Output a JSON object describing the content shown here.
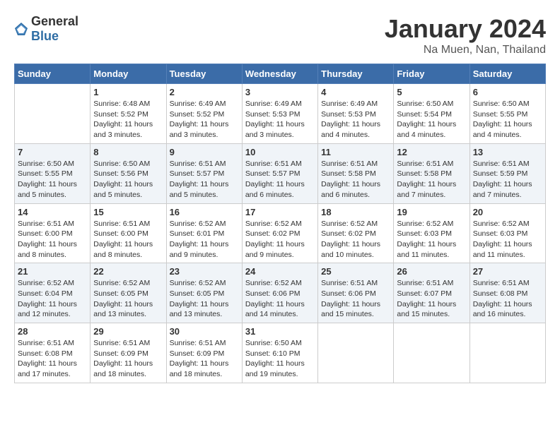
{
  "header": {
    "logo_general": "General",
    "logo_blue": "Blue",
    "month_year": "January 2024",
    "location": "Na Muen, Nan, Thailand"
  },
  "weekdays": [
    "Sunday",
    "Monday",
    "Tuesday",
    "Wednesday",
    "Thursday",
    "Friday",
    "Saturday"
  ],
  "weeks": [
    [
      {
        "day": "",
        "info": ""
      },
      {
        "day": "1",
        "info": "Sunrise: 6:48 AM\nSunset: 5:52 PM\nDaylight: 11 hours\nand 3 minutes."
      },
      {
        "day": "2",
        "info": "Sunrise: 6:49 AM\nSunset: 5:52 PM\nDaylight: 11 hours\nand 3 minutes."
      },
      {
        "day": "3",
        "info": "Sunrise: 6:49 AM\nSunset: 5:53 PM\nDaylight: 11 hours\nand 3 minutes."
      },
      {
        "day": "4",
        "info": "Sunrise: 6:49 AM\nSunset: 5:53 PM\nDaylight: 11 hours\nand 4 minutes."
      },
      {
        "day": "5",
        "info": "Sunrise: 6:50 AM\nSunset: 5:54 PM\nDaylight: 11 hours\nand 4 minutes."
      },
      {
        "day": "6",
        "info": "Sunrise: 6:50 AM\nSunset: 5:55 PM\nDaylight: 11 hours\nand 4 minutes."
      }
    ],
    [
      {
        "day": "7",
        "info": "Sunrise: 6:50 AM\nSunset: 5:55 PM\nDaylight: 11 hours\nand 5 minutes."
      },
      {
        "day": "8",
        "info": "Sunrise: 6:50 AM\nSunset: 5:56 PM\nDaylight: 11 hours\nand 5 minutes."
      },
      {
        "day": "9",
        "info": "Sunrise: 6:51 AM\nSunset: 5:57 PM\nDaylight: 11 hours\nand 5 minutes."
      },
      {
        "day": "10",
        "info": "Sunrise: 6:51 AM\nSunset: 5:57 PM\nDaylight: 11 hours\nand 6 minutes."
      },
      {
        "day": "11",
        "info": "Sunrise: 6:51 AM\nSunset: 5:58 PM\nDaylight: 11 hours\nand 6 minutes."
      },
      {
        "day": "12",
        "info": "Sunrise: 6:51 AM\nSunset: 5:58 PM\nDaylight: 11 hours\nand 7 minutes."
      },
      {
        "day": "13",
        "info": "Sunrise: 6:51 AM\nSunset: 5:59 PM\nDaylight: 11 hours\nand 7 minutes."
      }
    ],
    [
      {
        "day": "14",
        "info": "Sunrise: 6:51 AM\nSunset: 6:00 PM\nDaylight: 11 hours\nand 8 minutes."
      },
      {
        "day": "15",
        "info": "Sunrise: 6:51 AM\nSunset: 6:00 PM\nDaylight: 11 hours\nand 8 minutes."
      },
      {
        "day": "16",
        "info": "Sunrise: 6:52 AM\nSunset: 6:01 PM\nDaylight: 11 hours\nand 9 minutes."
      },
      {
        "day": "17",
        "info": "Sunrise: 6:52 AM\nSunset: 6:02 PM\nDaylight: 11 hours\nand 9 minutes."
      },
      {
        "day": "18",
        "info": "Sunrise: 6:52 AM\nSunset: 6:02 PM\nDaylight: 11 hours\nand 10 minutes."
      },
      {
        "day": "19",
        "info": "Sunrise: 6:52 AM\nSunset: 6:03 PM\nDaylight: 11 hours\nand 11 minutes."
      },
      {
        "day": "20",
        "info": "Sunrise: 6:52 AM\nSunset: 6:03 PM\nDaylight: 11 hours\nand 11 minutes."
      }
    ],
    [
      {
        "day": "21",
        "info": "Sunrise: 6:52 AM\nSunset: 6:04 PM\nDaylight: 11 hours\nand 12 minutes."
      },
      {
        "day": "22",
        "info": "Sunrise: 6:52 AM\nSunset: 6:05 PM\nDaylight: 11 hours\nand 13 minutes."
      },
      {
        "day": "23",
        "info": "Sunrise: 6:52 AM\nSunset: 6:05 PM\nDaylight: 11 hours\nand 13 minutes."
      },
      {
        "day": "24",
        "info": "Sunrise: 6:52 AM\nSunset: 6:06 PM\nDaylight: 11 hours\nand 14 minutes."
      },
      {
        "day": "25",
        "info": "Sunrise: 6:51 AM\nSunset: 6:06 PM\nDaylight: 11 hours\nand 15 minutes."
      },
      {
        "day": "26",
        "info": "Sunrise: 6:51 AM\nSunset: 6:07 PM\nDaylight: 11 hours\nand 15 minutes."
      },
      {
        "day": "27",
        "info": "Sunrise: 6:51 AM\nSunset: 6:08 PM\nDaylight: 11 hours\nand 16 minutes."
      }
    ],
    [
      {
        "day": "28",
        "info": "Sunrise: 6:51 AM\nSunset: 6:08 PM\nDaylight: 11 hours\nand 17 minutes."
      },
      {
        "day": "29",
        "info": "Sunrise: 6:51 AM\nSunset: 6:09 PM\nDaylight: 11 hours\nand 18 minutes."
      },
      {
        "day": "30",
        "info": "Sunrise: 6:51 AM\nSunset: 6:09 PM\nDaylight: 11 hours\nand 18 minutes."
      },
      {
        "day": "31",
        "info": "Sunrise: 6:50 AM\nSunset: 6:10 PM\nDaylight: 11 hours\nand 19 minutes."
      },
      {
        "day": "",
        "info": ""
      },
      {
        "day": "",
        "info": ""
      },
      {
        "day": "",
        "info": ""
      }
    ]
  ]
}
